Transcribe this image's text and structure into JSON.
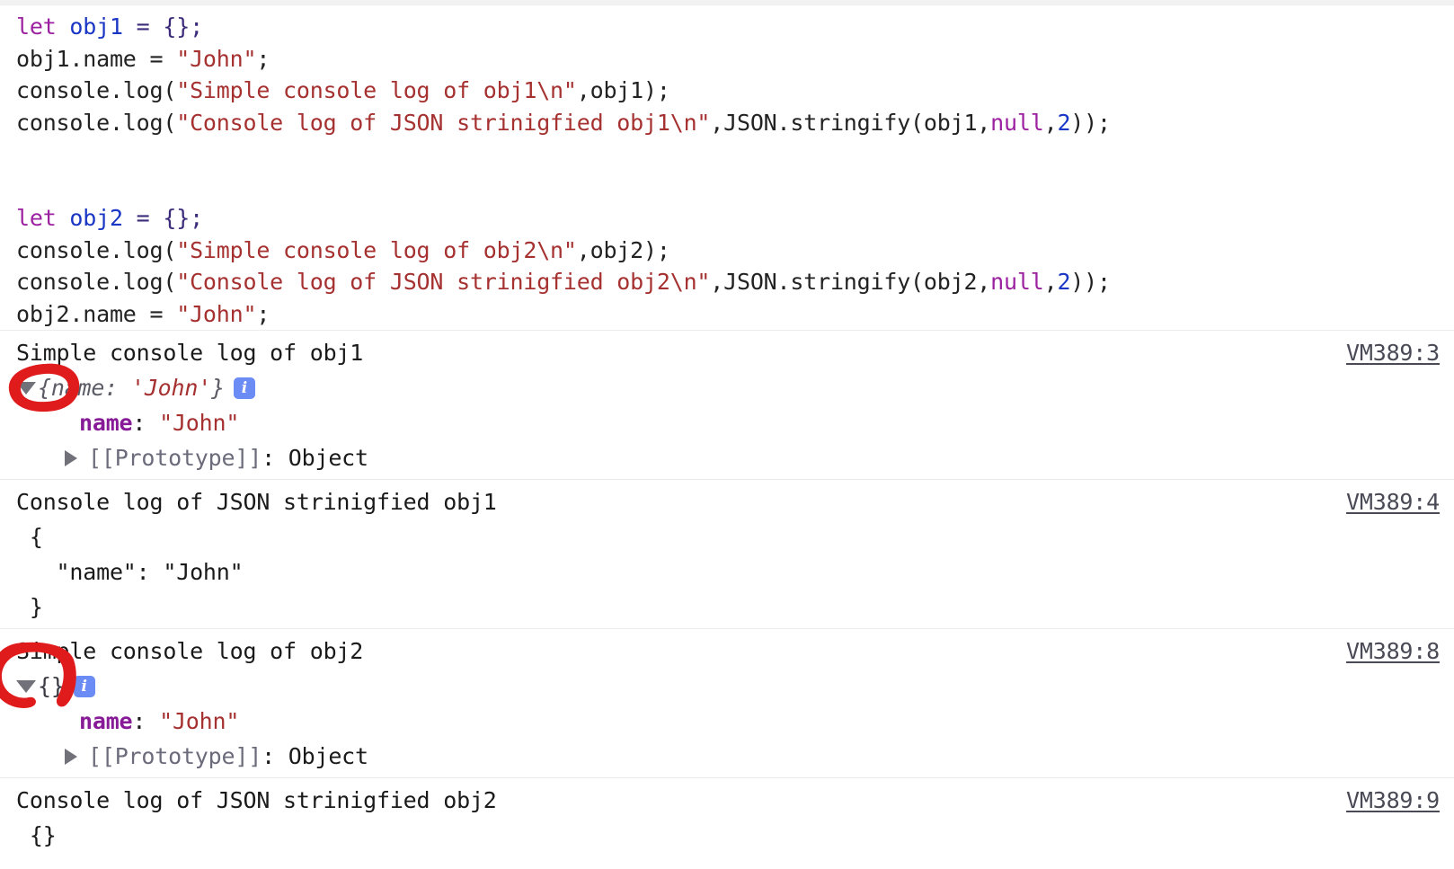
{
  "app": {
    "name": "chrome-devtools-console",
    "colors": {
      "keyword": "#9b21a0",
      "variable": "#1a36c4",
      "string": "#a53130",
      "property": "#871a96",
      "link": "#4a4a56",
      "info_badge": "#6c8cf5",
      "annotation_red": "#e01b1b",
      "separator": "#ececec",
      "background": "#ffffff"
    }
  },
  "editor": {
    "lines": [
      {
        "id": "line-1",
        "tokens": [
          {
            "t": "let",
            "c": "tok-kw"
          },
          {
            "t": " ",
            "c": "tok-plain"
          },
          {
            "t": "obj1",
            "c": "tok-var"
          },
          {
            "t": " = ",
            "c": "tok-punc"
          },
          {
            "t": "{};",
            "c": "tok-punc"
          }
        ]
      },
      {
        "id": "line-2",
        "tokens": [
          {
            "t": "obj1.name = ",
            "c": "tok-plain"
          },
          {
            "t": "\"John\"",
            "c": "tok-str"
          },
          {
            "t": ";",
            "c": "tok-plain"
          }
        ]
      },
      {
        "id": "line-3",
        "tokens": [
          {
            "t": "console.log(",
            "c": "tok-plain"
          },
          {
            "t": "\"Simple console log of obj1\\n\"",
            "c": "tok-str"
          },
          {
            "t": ",obj1);",
            "c": "tok-plain"
          }
        ]
      },
      {
        "id": "line-4",
        "tokens": [
          {
            "t": "console.log(",
            "c": "tok-plain"
          },
          {
            "t": "\"Console log of JSON strinigfied obj1\\n\"",
            "c": "tok-str"
          },
          {
            "t": ",JSON.stringify(obj1,",
            "c": "tok-plain"
          },
          {
            "t": "null",
            "c": "tok-null"
          },
          {
            "t": ",",
            "c": "tok-plain"
          },
          {
            "t": "2",
            "c": "tok-num"
          },
          {
            "t": "));",
            "c": "tok-plain"
          }
        ]
      },
      {
        "id": "line-5",
        "tokens": [
          {
            "t": " ",
            "c": "tok-plain"
          }
        ]
      },
      {
        "id": "line-6",
        "tokens": [
          {
            "t": " ",
            "c": "tok-plain"
          }
        ]
      },
      {
        "id": "line-7",
        "tokens": [
          {
            "t": "let",
            "c": "tok-kw"
          },
          {
            "t": " ",
            "c": "tok-plain"
          },
          {
            "t": "obj2",
            "c": "tok-var"
          },
          {
            "t": " = ",
            "c": "tok-punc"
          },
          {
            "t": "{};",
            "c": "tok-punc"
          }
        ]
      },
      {
        "id": "line-8",
        "tokens": [
          {
            "t": "console.log(",
            "c": "tok-plain"
          },
          {
            "t": "\"Simple console log of obj2\\n\"",
            "c": "tok-str"
          },
          {
            "t": ",obj2);",
            "c": "tok-plain"
          }
        ]
      },
      {
        "id": "line-9",
        "tokens": [
          {
            "t": "console.log(",
            "c": "tok-plain"
          },
          {
            "t": "\"Console log of JSON strinigfied obj2\\n\"",
            "c": "tok-str"
          },
          {
            "t": ",JSON.stringify(obj2,",
            "c": "tok-plain"
          },
          {
            "t": "null",
            "c": "tok-null"
          },
          {
            "t": ",",
            "c": "tok-plain"
          },
          {
            "t": "2",
            "c": "tok-num"
          },
          {
            "t": "));",
            "c": "tok-plain"
          }
        ]
      },
      {
        "id": "line-10",
        "tokens": [
          {
            "t": "obj2.name = ",
            "c": "tok-plain"
          },
          {
            "t": "\"John\"",
            "c": "tok-str"
          },
          {
            "t": ";",
            "c": "tok-plain"
          }
        ]
      }
    ]
  },
  "console": {
    "messages": [
      {
        "id": "msg-1",
        "header": "Simple console log of obj1",
        "source": "VM389:3",
        "expanded": true,
        "preview_prefix": "{",
        "preview_key": "name: ",
        "preview_value": "'John'",
        "preview_suffix": "}",
        "info_glyph": "i",
        "properties": [
          {
            "key": "name",
            "sep": ": ",
            "value": "\"John\""
          }
        ],
        "prototype_label": "[[Prototype]]",
        "prototype_sep": ": ",
        "prototype_value": "Object"
      },
      {
        "id": "msg-2",
        "header": "Console log of JSON strinigfied obj1",
        "source": "VM389:4",
        "text_lines": [
          " {",
          "   \"name\": \"John\"",
          " }"
        ]
      },
      {
        "id": "msg-3",
        "header": "Simple console log of obj2",
        "source": "VM389:8",
        "expanded": true,
        "preview_prefix": "{",
        "preview_key": "",
        "preview_value": "",
        "preview_suffix": "}",
        "info_glyph": "i",
        "properties": [
          {
            "key": "name",
            "sep": ": ",
            "value": "\"John\""
          }
        ],
        "prototype_label": "[[Prototype]]",
        "prototype_sep": ": ",
        "prototype_value": "Object"
      },
      {
        "id": "msg-4",
        "header": "Console log of JSON strinigfied obj2",
        "source": "VM389:9",
        "text_lines": [
          " {}"
        ]
      }
    ]
  },
  "annotations": [
    {
      "id": "annot-1",
      "shape": "hand-drawn-red-circle",
      "target": "expand-triangle of obj1 preview"
    },
    {
      "id": "annot-2",
      "shape": "hand-drawn-red-circle",
      "target": "expand-triangle of obj2 preview"
    }
  ]
}
